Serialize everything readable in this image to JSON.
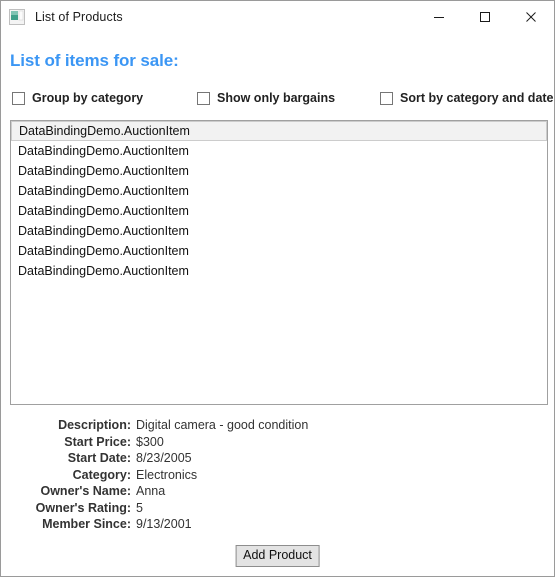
{
  "window": {
    "title": "List of Products",
    "icon": "application-window-icon",
    "controls": [
      {
        "name": "minimize-button",
        "icon": "minimize-icon",
        "label": "Minimize"
      },
      {
        "name": "maximize-button",
        "icon": "maximize-icon",
        "label": "Maximize"
      },
      {
        "name": "close-button",
        "icon": "close-icon",
        "label": "Close"
      }
    ]
  },
  "content": {
    "heading": "List of items for sale:",
    "heading_color": "#3b96f4",
    "checkboxes": [
      {
        "label": "Group by category",
        "checked": false
      },
      {
        "label": "Show only bargains",
        "checked": false
      },
      {
        "label": "Sort by category and date",
        "checked": false
      }
    ],
    "list": {
      "items": [
        {
          "text": "DataBindingDemo.AuctionItem",
          "selected": true
        },
        {
          "text": "DataBindingDemo.AuctionItem",
          "selected": false
        },
        {
          "text": "DataBindingDemo.AuctionItem",
          "selected": false
        },
        {
          "text": "DataBindingDemo.AuctionItem",
          "selected": false
        },
        {
          "text": "DataBindingDemo.AuctionItem",
          "selected": false
        },
        {
          "text": "DataBindingDemo.AuctionItem",
          "selected": false
        },
        {
          "text": "DataBindingDemo.AuctionItem",
          "selected": false
        },
        {
          "text": "DataBindingDemo.AuctionItem",
          "selected": false
        }
      ]
    },
    "details": [
      {
        "label": "Description:",
        "value": "Digital camera - good condition"
      },
      {
        "label": "Start Price:",
        "value": "$300"
      },
      {
        "label": "Start Date:",
        "value": "8/23/2005"
      },
      {
        "label": "Category:",
        "value": "Electronics"
      },
      {
        "label": "Owner's Name:",
        "value": "Anna"
      },
      {
        "label": "Owner's Rating:",
        "value": "5"
      },
      {
        "label": "Member Since:",
        "value": "9/13/2001"
      }
    ],
    "add_product_label": "Add Product"
  }
}
